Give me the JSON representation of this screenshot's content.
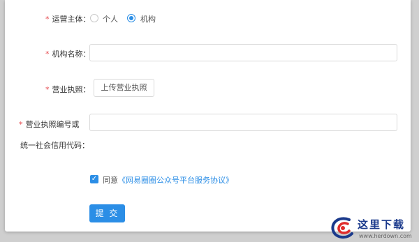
{
  "form": {
    "operator": {
      "required_mark": "*",
      "label": "运营主体：",
      "options": [
        {
          "label": "个人",
          "checked": false
        },
        {
          "label": "机构",
          "checked": true
        }
      ]
    },
    "org_name": {
      "required_mark": "*",
      "label": "机构名称：",
      "value": ""
    },
    "business_license": {
      "required_mark": "*",
      "label": "营业执照：",
      "upload_label": "上传营业执照"
    },
    "license_number": {
      "required_mark": "*",
      "label_line1": "营业执照编号或",
      "label_line2": "统一社会信用代码：",
      "value": ""
    },
    "agreement": {
      "checked": true,
      "prefix": "同意",
      "link_text": "《网易圈圈公众号平台服务协议》"
    },
    "submit_label": "提 交"
  },
  "watermark": {
    "text": "这里下载",
    "url": "www.herdown.com"
  },
  "colors": {
    "accent": "#2b8ee6",
    "required": "#e5484d",
    "background": "#cfcfcf",
    "panel": "#ffffff"
  }
}
